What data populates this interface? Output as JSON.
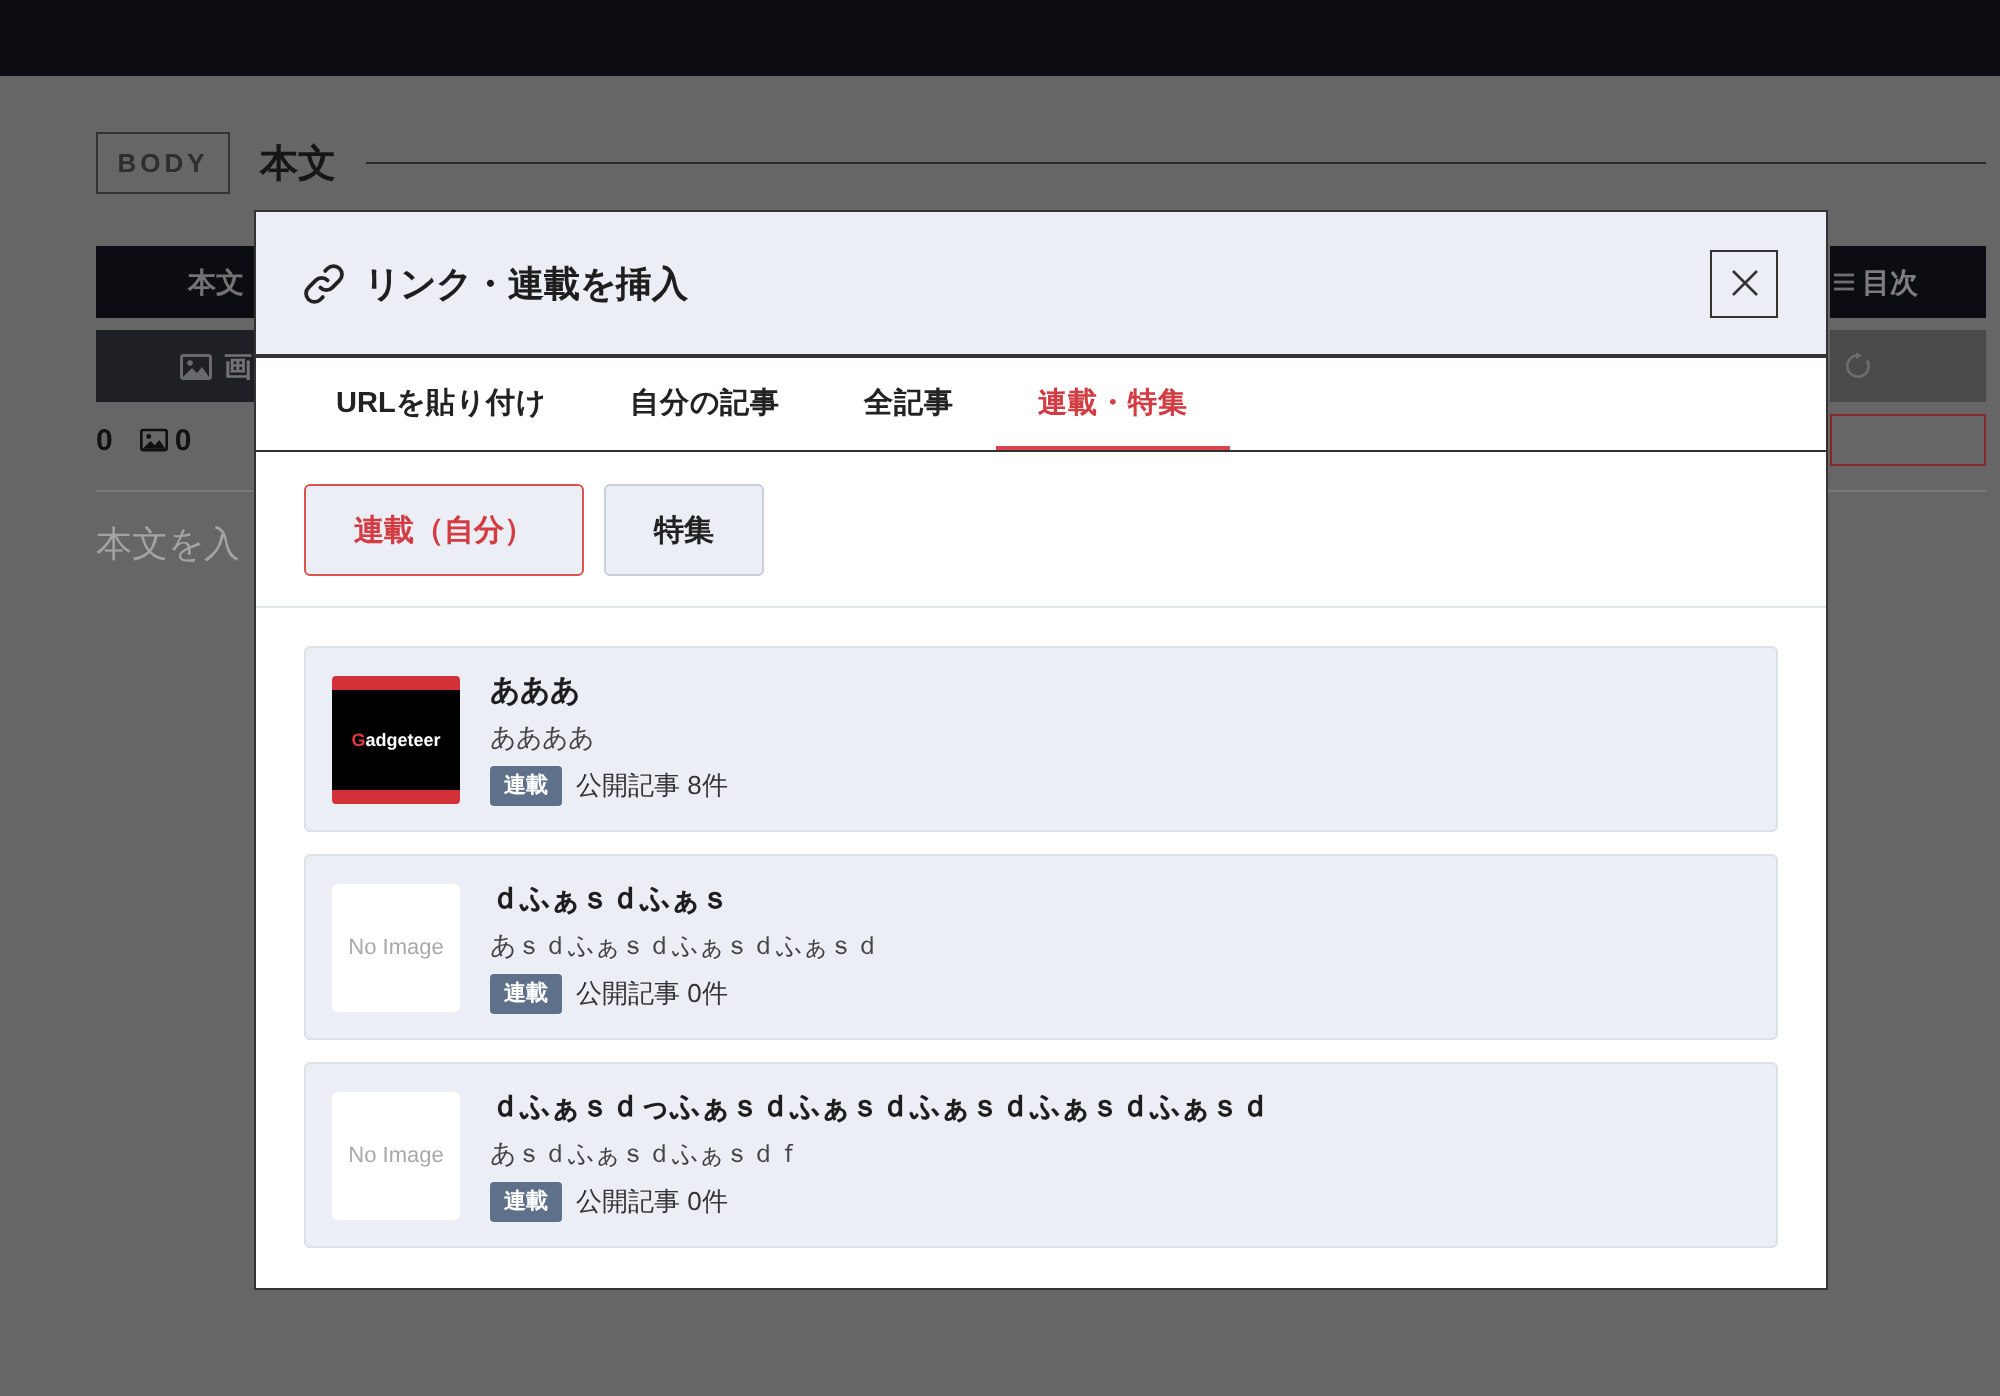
{
  "editor": {
    "badge": "BODY",
    "heading": "本文",
    "toolbar": [
      {
        "left": {
          "kind": "text",
          "label": "本文"
        },
        "right": {
          "kind": "list",
          "label": "目次"
        }
      },
      {
        "left": {
          "kind": "image",
          "label": "画"
        },
        "right": {
          "kind": "reload"
        }
      }
    ],
    "counts": [
      {
        "kind": "plain",
        "value": "0"
      },
      {
        "kind": "image",
        "value": "0"
      }
    ],
    "placeholder": "本文を入"
  },
  "dialog": {
    "title": "リンク・連載を挿入",
    "tabs": [
      {
        "label": "URLを貼り付け",
        "selected": false
      },
      {
        "label": "自分の記事",
        "selected": false
      },
      {
        "label": "全記事",
        "selected": false
      },
      {
        "label": "連載・特集",
        "selected": true
      }
    ],
    "filters": [
      {
        "label": "連載（自分）",
        "selected": true
      },
      {
        "label": "特集",
        "selected": false
      }
    ],
    "series": [
      {
        "thumbnail": {
          "kind": "logo",
          "text": "Gadgeteer"
        },
        "title": "あああ",
        "description": "ああああ",
        "tag": "連載",
        "count": "公開記事 8件"
      },
      {
        "thumbnail": {
          "kind": "none",
          "text": "No Image"
        },
        "title": "ｄふぁｓｄふぁｓ",
        "description": "あｓｄふぁｓｄふぁｓｄふぁｓｄ",
        "tag": "連載",
        "count": "公開記事 0件"
      },
      {
        "thumbnail": {
          "kind": "none",
          "text": "No Image"
        },
        "title": "ｄふぁｓｄっふぁｓｄふぁｓｄふぁｓｄふぁｓｄふぁｓｄ",
        "description": "あｓｄふぁｓｄふぁｓｄｆ",
        "tag": "連載",
        "count": "公開記事 0件"
      }
    ]
  }
}
